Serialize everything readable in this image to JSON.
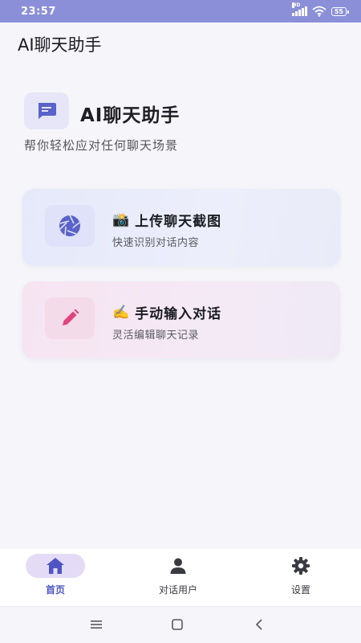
{
  "status_bar": {
    "time": "23:57",
    "network_tag": "HD",
    "battery": "55"
  },
  "app": {
    "title": "AI聊天助手"
  },
  "hero": {
    "icon": "chat-bubble-icon",
    "title": "AI聊天助手",
    "subtitle": "帮你轻松应对任何聊天场景"
  },
  "cards": [
    {
      "icon": "camera-shutter-icon",
      "emoji": "📸",
      "title": "上传聊天截图",
      "subtitle": "快速识别对话内容"
    },
    {
      "icon": "pencil-icon",
      "emoji": "✍️",
      "title": "手动输入对话",
      "subtitle": "灵活编辑聊天记录"
    }
  ],
  "bottom_nav": {
    "items": [
      {
        "label": "首页",
        "icon": "home-icon",
        "active": true
      },
      {
        "label": "对话用户",
        "icon": "person-icon",
        "active": false
      },
      {
        "label": "设置",
        "icon": "gear-icon",
        "active": false
      }
    ]
  },
  "colors": {
    "accent": "#4f56c4",
    "status_bar": "#8a8fd8",
    "upload_card": "#e6e9fa",
    "manual_card": "#f6e4f1",
    "pencil": "#e0457e",
    "shutter": "#5a63c9"
  }
}
